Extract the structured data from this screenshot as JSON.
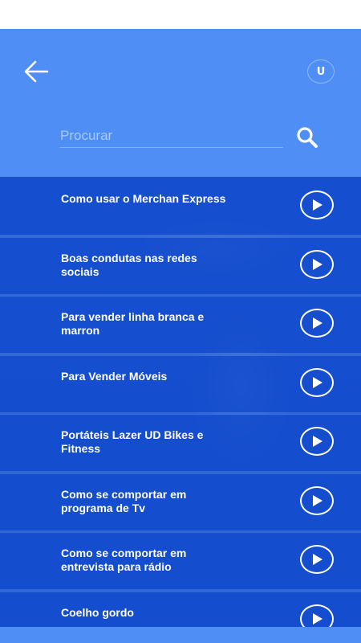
{
  "header": {
    "back_icon": "arrow-left-icon",
    "avatar_initial": "U"
  },
  "search": {
    "placeholder": "Procurar",
    "value": "",
    "icon": "search-icon"
  },
  "videos": [
    {
      "title": "Como usar o Merchan Express"
    },
    {
      "title": "Boas condutas nas redes sociais"
    },
    {
      "title": "Para vender linha branca e marron"
    },
    {
      "title": "Para Vender Móveis"
    },
    {
      "title": "Portáteis Lazer UD Bikes e Fitness"
    },
    {
      "title": "Como se comportar em programa de Tv"
    },
    {
      "title": "Como se comportar em entrevista para rádio"
    },
    {
      "title": "Coelho gordo"
    }
  ],
  "colors": {
    "header_bg": "#4f8ff5",
    "item_bg": "#144ed2",
    "text": "#ffffff"
  }
}
